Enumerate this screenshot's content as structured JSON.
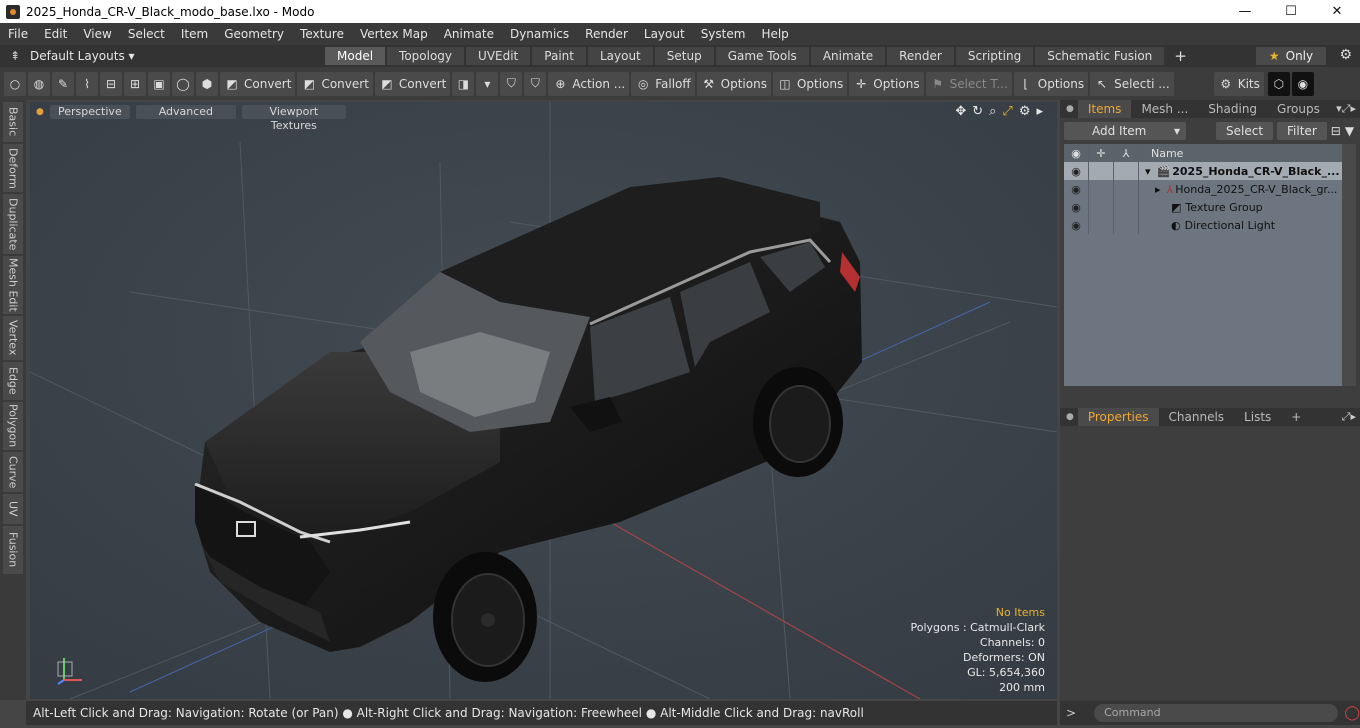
{
  "window": {
    "title": "2025_Honda_CR-V_Black_modo_base.lxo - Modo",
    "minimize": "—",
    "maximize": "☐",
    "close": "✕"
  },
  "menu": [
    "File",
    "Edit",
    "View",
    "Select",
    "Item",
    "Geometry",
    "Texture",
    "Vertex Map",
    "Animate",
    "Dynamics",
    "Render",
    "Layout",
    "System",
    "Help"
  ],
  "layouts": {
    "label": "Default Layouts ▾",
    "tabs": [
      "Model",
      "Topology",
      "UVEdit",
      "Paint",
      "Layout",
      "Setup",
      "Game Tools",
      "Animate",
      "Render",
      "Scripting",
      "Schematic Fusion"
    ],
    "active": "Model",
    "only": "Only"
  },
  "toolbar": {
    "convert1": "Convert",
    "convert2": "Convert",
    "convert3": "Convert",
    "action": "Action ...",
    "falloff": "Falloff",
    "options1": "Options",
    "options2": "Options",
    "options3": "Options",
    "select_t": "Select T...",
    "options4": "Options",
    "selecti": "Selecti ...",
    "kits": "Kits"
  },
  "lefttabs": [
    "Basic",
    "Deform",
    "Duplicate",
    "Mesh Edit",
    "Vertex",
    "Edge",
    "Polygon",
    "Curve",
    "UV",
    "Fusion"
  ],
  "viewport": {
    "buttons": [
      "Perspective",
      "Advanced",
      "Viewport Textures"
    ],
    "stats": {
      "no_items": "No Items",
      "polygons": "Polygons : Catmull-Clark",
      "channels": "Channels: 0",
      "deformers": "Deformers: ON",
      "gl": "GL: 5,654,360",
      "scale": "200 mm"
    }
  },
  "status": "Alt-Left Click and Drag: Navigation: Rotate (or Pan) ● Alt-Right Click and Drag: Navigation: Freewheel ● Alt-Middle Click and Drag: navRoll",
  "items_panel": {
    "tabs": [
      "Items",
      "Mesh ...",
      "Shading",
      "Groups"
    ],
    "add_item": "Add Item",
    "select": "Select",
    "filter": "Filter",
    "col_name": "Name",
    "rows": [
      {
        "label": "2025_Honda_CR-V_Black_...",
        "indent": 0
      },
      {
        "label": "Honda_2025_CR-V_Black_gr...",
        "indent": 1
      },
      {
        "label": "Texture Group",
        "indent": 1
      },
      {
        "label": "Directional Light",
        "indent": 1
      }
    ]
  },
  "props_panel": {
    "tabs": [
      "Properties",
      "Channels",
      "Lists"
    ],
    "plus": "+"
  },
  "command": {
    "placeholder": "Command",
    "prompt": ">"
  },
  "colors": {
    "accent": "#f0a732",
    "viewport_bg": "#3b4249"
  }
}
